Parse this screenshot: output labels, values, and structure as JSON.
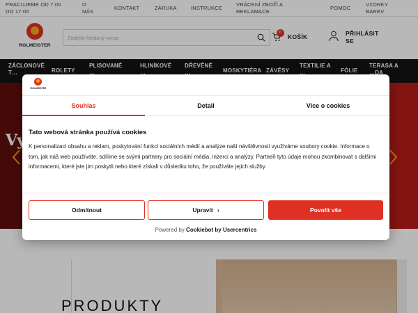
{
  "topbar": {
    "hours": "PRACUJEME OD 7:00 DO 17:00",
    "about": "O NÁS",
    "contact": "KONTAKT",
    "warranty": "ZÁRUKA",
    "instructions": "INSTRUKCE",
    "returns": "VRÁCENÍ ZBOŽÍ A REKLAMACE",
    "help": "POMOC",
    "samples": "VZORKY BAREV"
  },
  "header": {
    "logo_text": "ROLMEISTER",
    "search_placeholder": "Zadejte hledaný výraz",
    "cart_count": "0",
    "cart_label": "KOŠÍK",
    "login_label": "PŘIHLÁSIT SE"
  },
  "nav": {
    "items": [
      "ZÁCLONOVÉ T…",
      "ROLETY",
      "PLISOVANÉ …",
      "HLINÍKOVÉ …",
      "DŘEVĚNÉ …",
      "MOSKYTIÉRA",
      "ZÁVĚSY",
      "TEXTILIE A …",
      "FÓLIE",
      "TERASA A …DA"
    ]
  },
  "hero": {
    "text": "Vy"
  },
  "main": {
    "products_title": "PRODUKTY"
  },
  "cookie": {
    "logo_text": "ROLMEISTER",
    "tabs": [
      "Souhlas",
      "Detail",
      "Více o cookies"
    ],
    "heading": "Tato webová stránka používá cookies",
    "body": "K personalizaci obsahu a reklam, poskytování funkcí sociálních médií a analýze naší návštěvnosti využíváme soubory cookie. Informace o tom, jak náš web používáte, sdílíme se svými partnery pro sociální média, inzerci a analýzy. Partneři tyto údaje mohou zkombinovat s dalšími informacemi, které jste jim poskytli nebo které získali v důsledku toho, že používáte jejich služby.",
    "btn_reject": "Odmítnout",
    "btn_customize": "Upravit",
    "btn_allow": "Povolit vše",
    "powered_prefix": "Powered by",
    "powered_brand": "Cookiebot by Usercentrics"
  },
  "colors": {
    "brand_red": "#e03024",
    "nav_bg": "#141414",
    "logo_orange": "#f6a623"
  },
  "icons": [
    "search-icon",
    "cart-icon",
    "user-icon",
    "chevron-left-icon",
    "chevron-right-icon",
    "chevron-right-small-icon"
  ]
}
